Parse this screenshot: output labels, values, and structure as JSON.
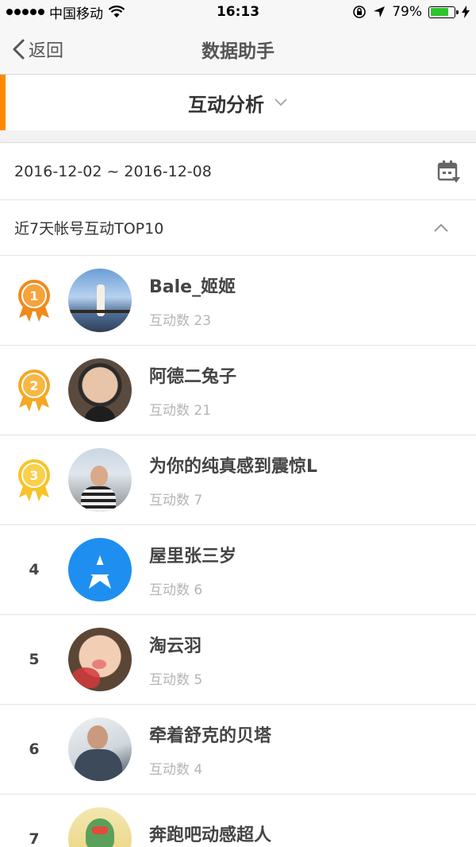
{
  "status": {
    "carrier": "中国移动",
    "time": "16:13",
    "battery_pct": "79%",
    "battery_level": 0.79
  },
  "nav": {
    "back_label": "返回",
    "title": "数据助手"
  },
  "selector": {
    "label": "互动分析"
  },
  "date_range": "2016-12-02 ~ 2016-12-08",
  "section": {
    "title": "近7天帐号互动TOP10"
  },
  "colors": {
    "accent": "#ff8a00",
    "medal_1": "#f08a1c",
    "medal_2": "#f4a825",
    "medal_3": "#f8c326"
  },
  "ranking": [
    {
      "rank": "1",
      "name": "Bale_姬姬",
      "count": "互动数 23"
    },
    {
      "rank": "2",
      "name": "阿德二兔子",
      "count": "互动数 21"
    },
    {
      "rank": "3",
      "name": "为你的纯真感到震惊L",
      "count": "互动数 7"
    },
    {
      "rank": "4",
      "name": "屋里张三岁",
      "count": "互动数 6"
    },
    {
      "rank": "5",
      "name": "淘云羽",
      "count": "互动数 5"
    },
    {
      "rank": "6",
      "name": "牵着舒克的贝塔",
      "count": "互动数 4"
    },
    {
      "rank": "7",
      "name": "奔跑吧动感超人",
      "count": ""
    }
  ]
}
